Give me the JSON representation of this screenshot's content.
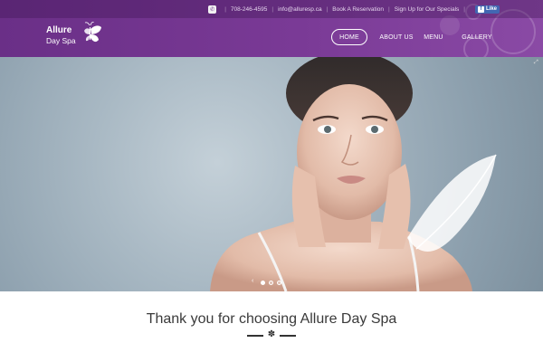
{
  "topbar": {
    "phone": "708-246-4595",
    "email": "info@alluresp.ca",
    "links": [
      "Book A Reservation",
      "Sign Up for Our Specials"
    ],
    "facebook_like": "Like"
  },
  "logo": {
    "line1": "Allure",
    "line2": "Day Spa"
  },
  "nav": {
    "items": [
      {
        "label": "HOME"
      },
      {
        "label": "ABOUT US"
      },
      {
        "label": "MENU"
      },
      {
        "label": "GALLERY"
      }
    ]
  },
  "slider": {
    "slide_count": 3,
    "active_slide": 1
  },
  "welcome": {
    "title": "Thank you for choosing Allure Day Spa"
  },
  "colors": {
    "header": "#6a2f87",
    "hero_bg": "#9aabb8",
    "text": "#3a3a3a"
  }
}
